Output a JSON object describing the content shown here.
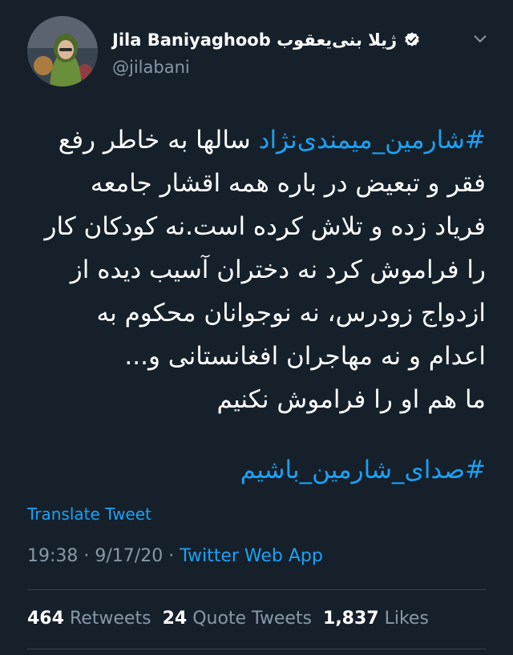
{
  "author": {
    "name": "Jila Baniyaghoob ژيلا بنی‌یعقوب",
    "handle": "@jilabani",
    "avatar_icon": "avatar-photo",
    "verified_icon": "verified-badge-icon"
  },
  "tweet": {
    "lines": [
      {
        "hashtag": "#شارمین_میمندی‌نژاد",
        "text": " سالها به خاطر رفع"
      },
      {
        "text": "فقر و تبعیض در باره همه اقشار جامعه"
      },
      {
        "text": "فریاد زده و تلاش کرده است.نه کودکان کار"
      },
      {
        "text": "را فراموش کرد نه دختران آسیب دیده از"
      },
      {
        "text": "ازدواج زودرس، نه نوجوانان محکوم به"
      },
      {
        "text": "اعدام  و نه مهاجران افغانستانی و..."
      },
      {
        "text": "ما هم او را فراموش  نکنیم"
      }
    ],
    "closing_hashtag": "#صدای_شارمین_باشیم"
  },
  "translate_label": "Translate Tweet",
  "meta": {
    "time": "19:38",
    "separator1": " · ",
    "date": "9/17/20",
    "separator2": " · ",
    "source": "Twitter Web App"
  },
  "stats": {
    "retweets_count": "464",
    "retweets_label": "Retweets",
    "quotes_count": "24",
    "quotes_label": "Quote Tweets",
    "likes_count": "1,837",
    "likes_label": "Likes"
  },
  "colors": {
    "background": "#15202b",
    "accent": "#1da1f2",
    "secondary_text": "#8899a6",
    "divider": "#38444d"
  }
}
